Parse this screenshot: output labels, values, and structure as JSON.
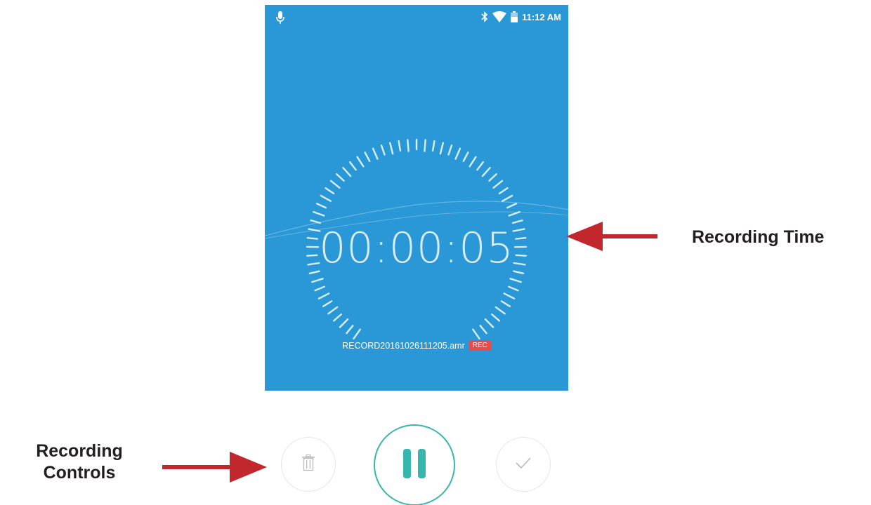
{
  "status_bar": {
    "time": "11:12 AM",
    "icons": [
      "microphone-icon",
      "bluetooth-icon",
      "wifi-icon",
      "battery-icon"
    ]
  },
  "recorder": {
    "elapsed_time": "00:00:05",
    "file_name": "RECORD20161026111205.amr",
    "file_badge": "REC"
  },
  "controls": {
    "delete_icon": "trash-icon",
    "pause_icon": "pause-icon",
    "confirm_icon": "check-icon"
  },
  "callouts": {
    "recording_time": "Recording Time",
    "recording_controls_line1": "Recording",
    "recording_controls_line2": "Controls"
  },
  "colors": {
    "screen_background": "#2a98d6",
    "accent": "#36b6ae",
    "badge": "#e84b4b",
    "arrow": "#c1272d"
  }
}
